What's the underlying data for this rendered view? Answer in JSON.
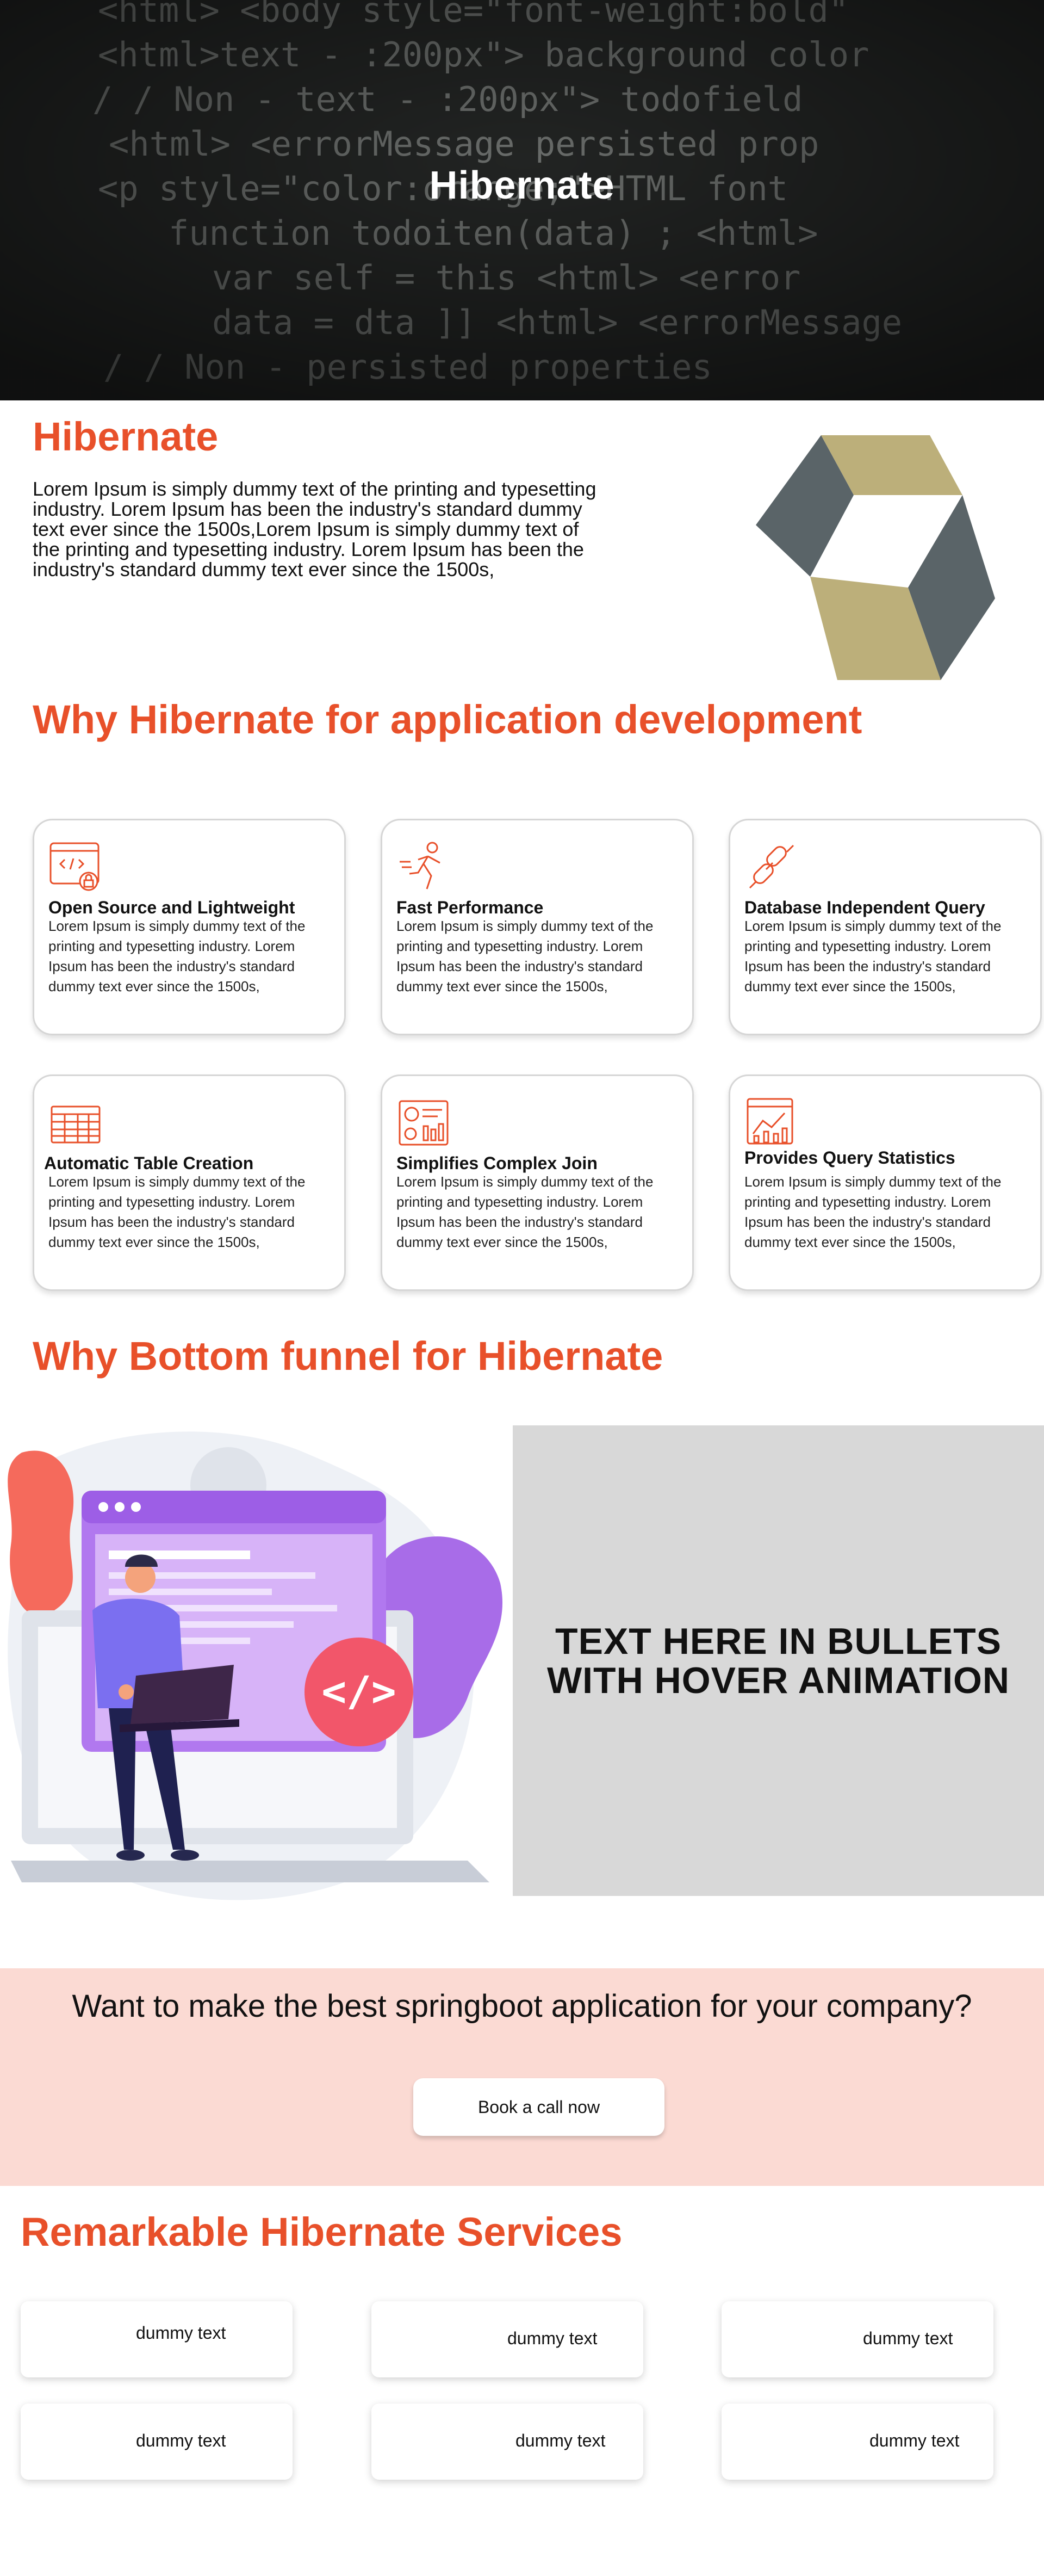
{
  "hero": {
    "title": "Hibernate",
    "code_lines": [
      "<html> <body style=\"font-weight:bold\"",
      "<html>text - :200px\"> background color",
      "/ / Non - text - :200px\"> todofield",
      "<html> <errorMessage persisted prop",
      "<p style=\"color:orange;\">HTML font",
      "function todoiten(data) ; <html>",
      "var self = this <html> <error",
      "data = dta ]] <html> <errorMessage",
      "/ / Non - persisted properties"
    ]
  },
  "intro": {
    "title": "Hibernate",
    "text": "Lorem Ipsum is simply dummy text of the printing and typesetting industry. Lorem Ipsum has been the industry's standard dummy text ever since the 1500s,Lorem Ipsum is simply dummy text of the printing and typesetting industry. Lorem Ipsum has been the industry's standard dummy text ever since the 1500s,",
    "logo": "hibernate-logo"
  },
  "why": {
    "title": "Why Hibernate for application development",
    "cards": [
      {
        "title": "Open Source and Lightweight",
        "text": "Lorem Ipsum is simply dummy text of the printing and typesetting industry. Lorem Ipsum has been the industry's standard dummy text ever since the 1500s,",
        "icon": "code-window-icon"
      },
      {
        "title": "Fast Performance",
        "text": "Lorem Ipsum is simply dummy text of the printing and typesetting industry. Lorem Ipsum has been the industry's standard dummy text ever since the 1500s,",
        "icon": "running-person-icon"
      },
      {
        "title": "Database Independent Query",
        "text": "Lorem Ipsum is simply dummy text of the printing and typesetting industry. Lorem Ipsum has been the industry's standard dummy text ever since the 1500s,",
        "icon": "chain-link-icon"
      },
      {
        "title": "Automatic Table Creation",
        "text": "Lorem Ipsum is simply dummy text of the printing and typesetting industry. Lorem Ipsum has been the industry's standard dummy text ever since the 1500s,",
        "icon": "table-icon"
      },
      {
        "title": "Simplifies Complex Join",
        "text": "Lorem Ipsum is simply dummy text of the printing and typesetting industry. Lorem Ipsum has been the industry's standard dummy text ever since the 1500s,",
        "icon": "dashboard-icon"
      },
      {
        "title": "Provides Query Statistics",
        "text": "Lorem Ipsum is simply dummy text of the printing and typesetting industry. Lorem Ipsum has been the industry's standard dummy text ever since the 1500s,",
        "icon": "statistics-chart-icon"
      }
    ]
  },
  "funnel": {
    "title": "Why Bottom funnel for Hibernate",
    "placeholder": "TEXT HERE IN BULLETS WITH HOVER ANIMATION",
    "illustration": "developer-with-laptop-illustration"
  },
  "cta": {
    "question": "Want to make the best springboot application for your company?",
    "button": "Book a call now"
  },
  "services": {
    "title": "Remarkable Hibernate Services",
    "items": [
      "dummy text",
      "dummy text",
      "dummy text",
      "dummy text",
      "dummy text",
      "dummy text"
    ]
  },
  "colors": {
    "accent": "#e8502a",
    "cta_background": "#fbdad3",
    "placeholder_gray": "#d8d8d8",
    "logo_gold": "#bcaf7a",
    "logo_slate": "#5a6468"
  }
}
